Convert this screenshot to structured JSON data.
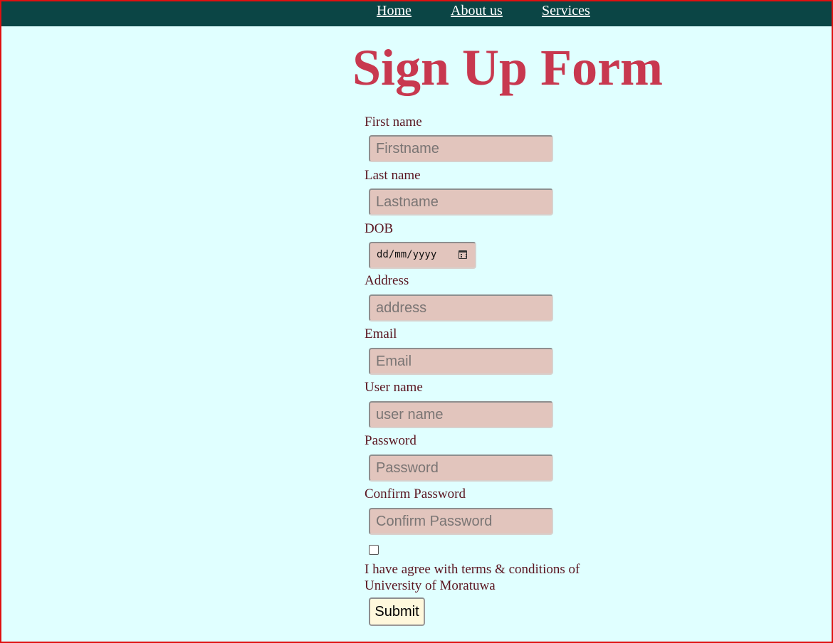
{
  "nav": {
    "home": "Home",
    "about": "About us",
    "services": "Services"
  },
  "title": "Sign Up Form",
  "form": {
    "first_name_label": "First name",
    "first_name_placeholder": "Firstname",
    "last_name_label": "Last name",
    "last_name_placeholder": "Lastname",
    "dob_label": "DOB",
    "dob_placeholder": "dd/mm/yyyy",
    "address_label": "Address",
    "address_placeholder": "address",
    "email_label": "Email",
    "email_placeholder": "Email",
    "username_label": "User name",
    "username_placeholder": "user name",
    "password_label": "Password",
    "password_placeholder": "Password",
    "confirm_label": "Confirm Password",
    "confirm_placeholder": "Confirm Password",
    "terms_text": "I have agree with terms & conditions of University of Moratuwa",
    "submit_label": "Submit"
  },
  "colors": {
    "navbar": "#0b4545",
    "background": "#e0ffff",
    "title": "#c8384f",
    "input_bg": "#e2c5bd",
    "submit_bg": "#fff8dc"
  }
}
